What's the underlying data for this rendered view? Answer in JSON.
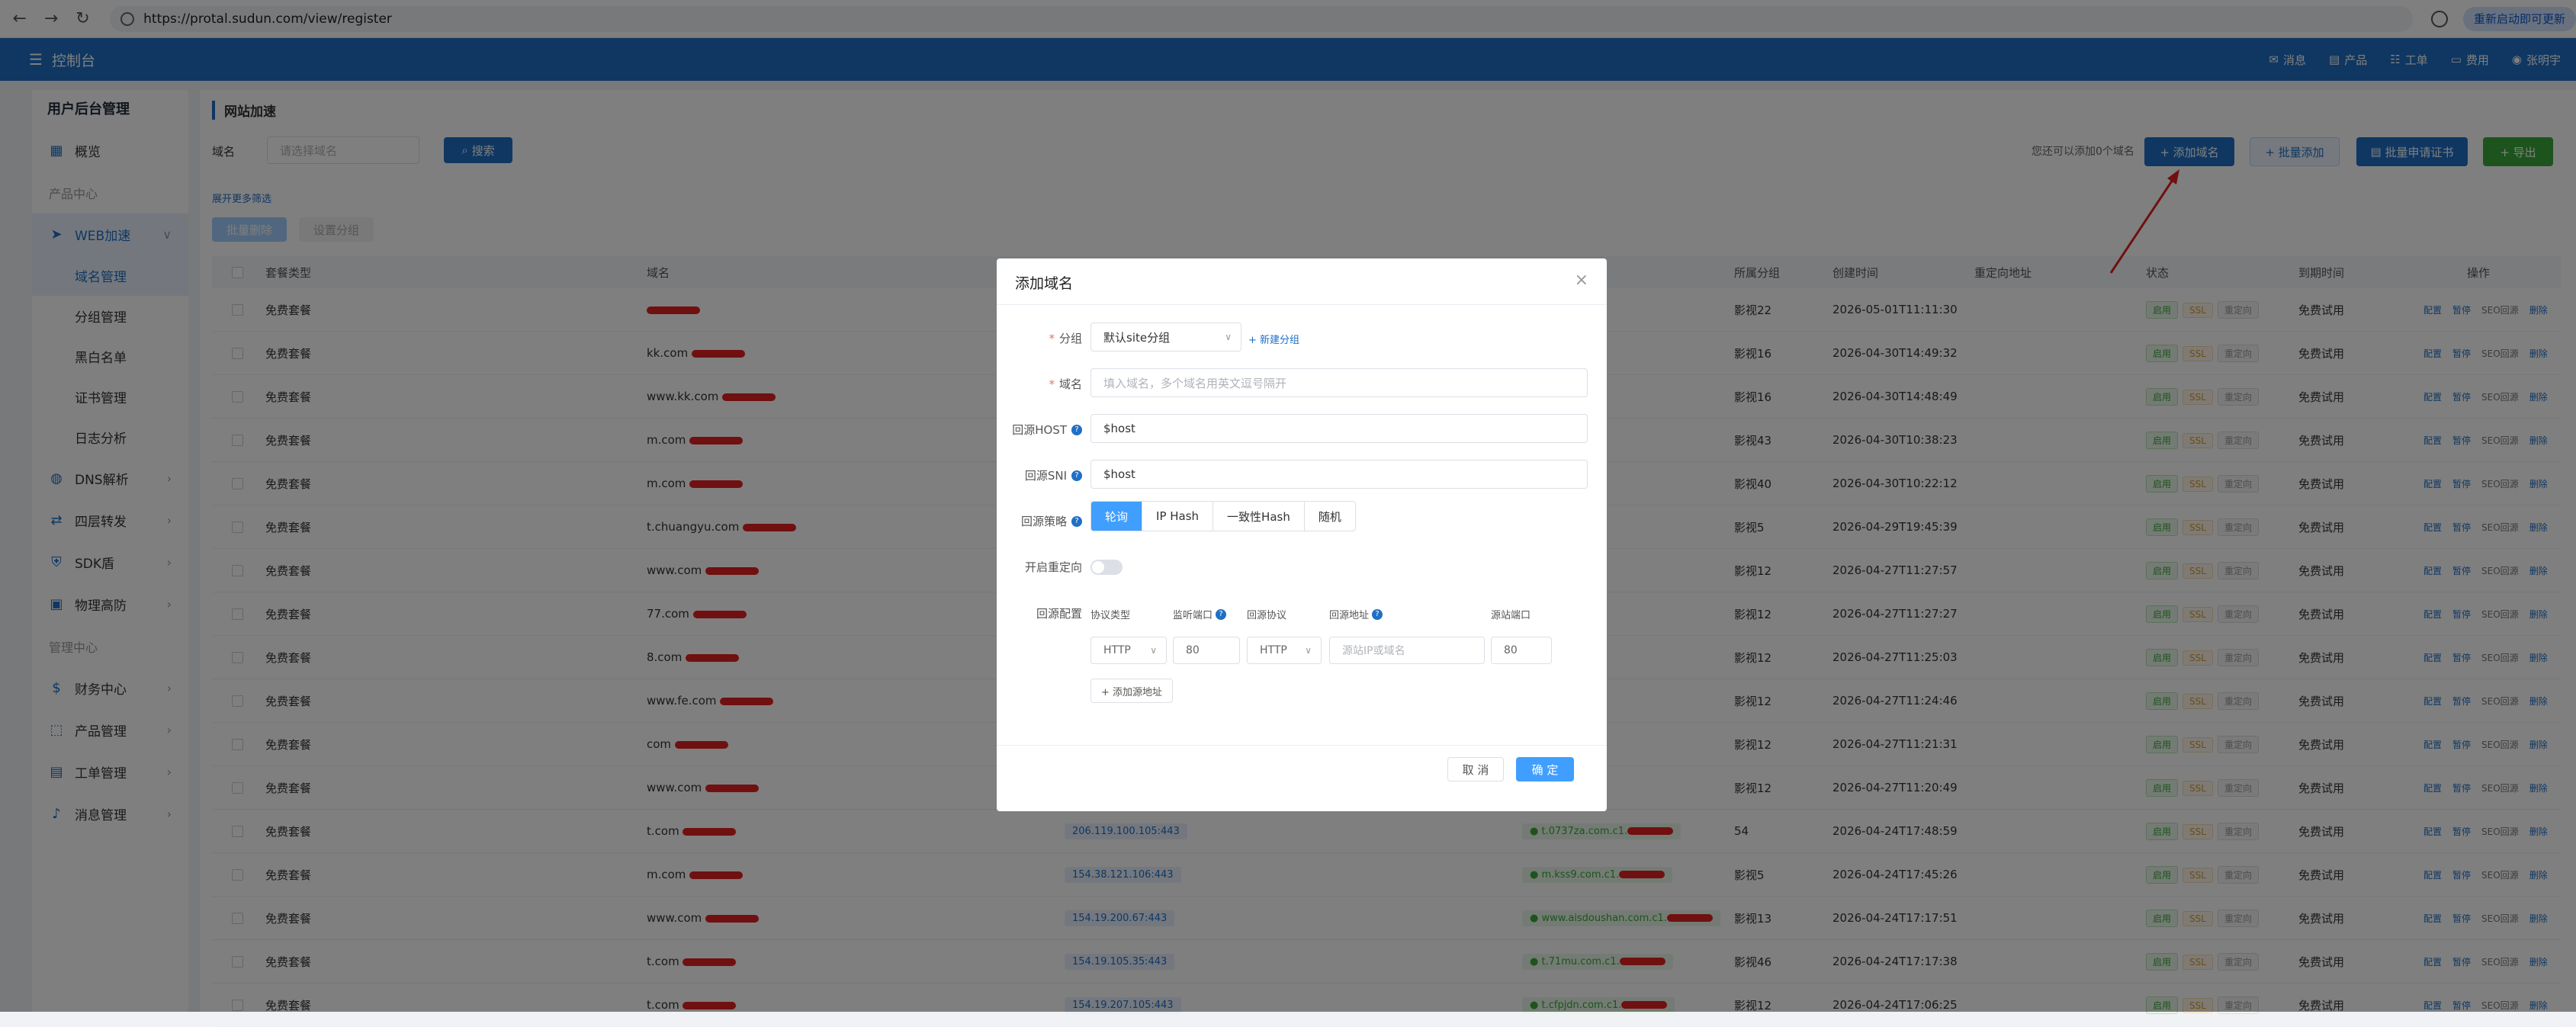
{
  "browser": {
    "url": "https://protal.sudun.com/view/register",
    "restart_label": "重新启动即可更新"
  },
  "topbar": {
    "brand": "控制台",
    "menu": [
      "消息",
      "产品",
      "工单",
      "费用",
      "张明宇"
    ]
  },
  "sidebar": {
    "head": "用户后台管理",
    "items": [
      {
        "label": "概览",
        "icon": "grid-icon"
      },
      {
        "label": "产品中心",
        "group": true
      },
      {
        "label": "WEB加速",
        "icon": "send-icon",
        "active": true,
        "expanded": true
      },
      {
        "label": "域名管理",
        "sub": true,
        "active": true
      },
      {
        "label": "分组管理",
        "sub": true
      },
      {
        "label": "黑白名单",
        "sub": true
      },
      {
        "label": "证书管理",
        "sub": true
      },
      {
        "label": "日志分析",
        "sub": true
      },
      {
        "label": "DNS解析",
        "icon": "globe-icon"
      },
      {
        "label": "四层转发",
        "icon": "forward-icon"
      },
      {
        "label": "SDK盾",
        "icon": "shield-icon"
      },
      {
        "label": "物理高防",
        "icon": "server-icon"
      },
      {
        "label": "管理中心",
        "group": true
      },
      {
        "label": "财务中心",
        "icon": "money-icon"
      },
      {
        "label": "产品管理",
        "icon": "box-icon"
      },
      {
        "label": "工单管理",
        "icon": "ticket-icon"
      },
      {
        "label": "消息管理",
        "icon": "bell-icon"
      }
    ]
  },
  "content": {
    "title": "网站加速",
    "domain_label": "域名",
    "domain_placeholder": "请选择域名",
    "search_label": "搜索",
    "quota_text": "您还可以添加0个域名",
    "add_domain": "+ 添加域名",
    "batch_add": "+ 批量添加",
    "batch_cert": "批量申请证书",
    "export": "+ 导出",
    "more_filter": "展开更多筛选",
    "batch_delete": "批量删除",
    "set_group": "设置分组"
  },
  "table": {
    "headers": [
      "套餐类型",
      "域名",
      "所属分组",
      "创建时间",
      "重定向地址",
      "状态",
      "到期时间",
      "操作"
    ],
    "rows": [
      {
        "plan": "免费套餐",
        "domain": "",
        "ip": "",
        "cname": "",
        "group": "影视22",
        "created": "2026-05-01T11:11:30",
        "expire": "免费试用"
      },
      {
        "plan": "免费套餐",
        "domain": "kk.com",
        "ip": "",
        "cname": "",
        "group": "影视16",
        "created": "2026-04-30T14:49:32",
        "expire": "免费试用"
      },
      {
        "plan": "免费套餐",
        "domain": "www.kk.com",
        "ip": "",
        "cname": "",
        "group": "影视16",
        "created": "2026-04-30T14:48:49",
        "expire": "免费试用"
      },
      {
        "plan": "免费套餐",
        "domain": "m.com",
        "ip": "",
        "cname": "",
        "group": "影视43",
        "created": "2026-04-30T10:38:23",
        "expire": "免费试用"
      },
      {
        "plan": "免费套餐",
        "domain": "m.com",
        "ip": "",
        "cname": "",
        "group": "影视40",
        "created": "2026-04-30T10:22:12",
        "expire": "免费试用"
      },
      {
        "plan": "免费套餐",
        "domain": "t.chuangyu.com",
        "ip": "",
        "cname": "",
        "group": "影视5",
        "created": "2026-04-29T19:45:39",
        "expire": "免费试用"
      },
      {
        "plan": "免费套餐",
        "domain": "www.com",
        "ip": "",
        "cname": "",
        "group": "影视12",
        "created": "2026-04-27T11:27:57",
        "expire": "免费试用"
      },
      {
        "plan": "免费套餐",
        "domain": "77.com",
        "ip": "",
        "cname": "",
        "group": "影视12",
        "created": "2026-04-27T11:27:27",
        "expire": "免费试用"
      },
      {
        "plan": "免费套餐",
        "domain": "8.com",
        "ip": "",
        "cname": "",
        "group": "影视12",
        "created": "2026-04-27T11:25:03",
        "expire": "免费试用"
      },
      {
        "plan": "免费套餐",
        "domain": "www.fe.com",
        "ip": "",
        "cname": "",
        "group": "影视12",
        "created": "2026-04-27T11:24:46",
        "expire": "免费试用"
      },
      {
        "plan": "免费套餐",
        "domain": "com",
        "ip": "",
        "cname": "",
        "group": "影视12",
        "created": "2026-04-27T11:21:31",
        "expire": "免费试用"
      },
      {
        "plan": "免费套餐",
        "domain": "www.com",
        "ip": "",
        "cname": "",
        "group": "影视12",
        "created": "2026-04-27T11:20:49",
        "expire": "免费试用"
      },
      {
        "plan": "免费套餐",
        "domain": "t.com",
        "ip": "206.119.100.105:443",
        "cname": "t.0737za.com.c1.",
        "group": "54",
        "created": "2026-04-24T17:48:59",
        "expire": "免费试用"
      },
      {
        "plan": "免费套餐",
        "domain": "m.com",
        "ip": "154.38.121.106:443",
        "cname": "m.kss9.com.c1.",
        "group": "影视5",
        "created": "2026-04-24T17:45:26",
        "expire": "免费试用"
      },
      {
        "plan": "免费套餐",
        "domain": "www.com",
        "ip": "154.19.200.67:443",
        "cname": "www.aisdoushan.com.c1.",
        "group": "影视13",
        "created": "2026-04-24T17:17:51",
        "expire": "免费试用"
      },
      {
        "plan": "免费套餐",
        "domain": "t.com",
        "ip": "154.19.105.35:443",
        "cname": "t.71mu.com.c1.",
        "group": "影视46",
        "created": "2026-04-24T17:17:38",
        "expire": "免费试用"
      },
      {
        "plan": "免费套餐",
        "domain": "t.com",
        "ip": "154.19.207.105:443",
        "cname": "t.cfpjdn.com.c1.",
        "group": "影视12",
        "created": "2026-04-24T17:06:25",
        "expire": "免费试用"
      }
    ],
    "status_tags": [
      "启用",
      "SSL",
      "重定向"
    ],
    "ops": [
      "配置",
      "暂停",
      "SEO回源",
      "删除"
    ]
  },
  "dialog": {
    "title": "添加域名",
    "group_label": "分组",
    "group_value": "默认site分组",
    "new_group": "+ 新建分组",
    "domain_label": "域名",
    "domain_placeholder": "填入域名，多个域名用英文逗号隔开",
    "host_label": "回源HOST",
    "host_value": "$host",
    "sni_label": "回源SNI",
    "sni_value": "$host",
    "strategy_label": "回源策略",
    "strategies": [
      "轮询",
      "IP Hash",
      "一致性Hash",
      "随机"
    ],
    "redirect_label": "开启重定向",
    "config_label": "回源配置",
    "col_proto": "协议类型",
    "col_listen": "监听端口",
    "col_origin_proto": "回源协议",
    "col_origin_addr": "回源地址",
    "col_origin_port": "源站端口",
    "proto_value": "HTTP",
    "listen_port": "80",
    "origin_proto_value": "HTTP",
    "origin_addr_placeholder": "源站IP或域名",
    "origin_port": "80",
    "add_origin": "+ 添加源地址",
    "cancel": "取 消",
    "confirm": "确 定"
  }
}
